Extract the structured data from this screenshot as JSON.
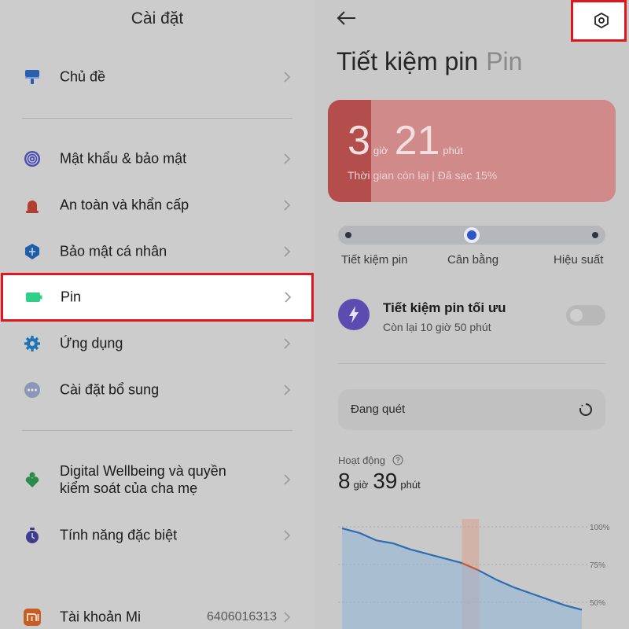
{
  "left": {
    "title": "Cài đặt",
    "items": [
      {
        "label": "Chủ đề"
      },
      {
        "label": "Mật khẩu & bảo mật"
      },
      {
        "label": "An toàn và khẩn cấp"
      },
      {
        "label": "Bảo mật cá nhân"
      },
      {
        "label": "Pin"
      },
      {
        "label": "Ứng dụng"
      },
      {
        "label": "Cài đặt bổ sung"
      },
      {
        "label_line1": "Digital Wellbeing và quyền",
        "label_line2": "kiểm soát của cha mẹ"
      },
      {
        "label": "Tính năng đặc biệt"
      },
      {
        "label": "Tài khoản Mi",
        "value": "6406016313"
      }
    ]
  },
  "right": {
    "title": "Tiết kiệm pin",
    "subtitle": "Pin",
    "battery": {
      "hours": "3",
      "hours_unit": "giờ",
      "minutes": "21",
      "minutes_unit": "phút",
      "caption": "Thời gian còn lại | Đã sạc 15%",
      "charge_percent": 15
    },
    "modes": [
      "Tiết kiệm pin",
      "Cân bằng",
      "Hiệu suất"
    ],
    "selected_mode": "Cân bằng",
    "ultra": {
      "title": "Tiết kiệm pin tối ưu",
      "subtitle": "Còn lại 10 giờ 50 phút",
      "enabled": false
    },
    "scan": {
      "label": "Đang quét"
    },
    "activity": {
      "label": "Hoạt động",
      "hours": "8",
      "hours_unit": "giờ",
      "minutes": "39",
      "minutes_unit": "phút"
    }
  },
  "chart_data": {
    "type": "area",
    "y_ticks": [
      "100%",
      "75%",
      "50%"
    ],
    "ylim": [
      0,
      100
    ],
    "x": [
      0,
      1,
      2,
      3,
      4,
      5,
      6,
      7,
      8,
      9,
      10,
      11,
      12,
      13,
      14
    ],
    "values": [
      99,
      96,
      91,
      89,
      85,
      82,
      79,
      76,
      71,
      65,
      60,
      56,
      52,
      48,
      45
    ],
    "highlight_x": [
      7,
      8
    ]
  },
  "colors": {
    "highlight": "#e0161d",
    "battery_low": "#b44e4d",
    "toggle_accent": "#5c4bb0",
    "chart_line": "#2b6cb2",
    "chart_segment": "#c25a3a"
  }
}
